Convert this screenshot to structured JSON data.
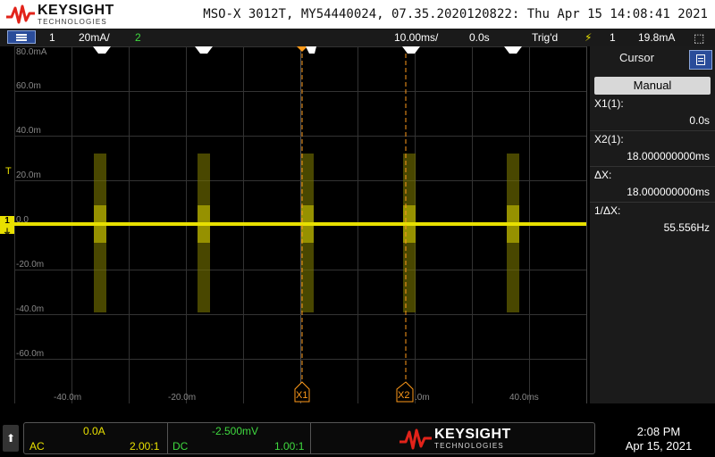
{
  "header": {
    "brand": "KEYSIGHT",
    "brand_sub": "TECHNOLOGIES",
    "info": "MSO-X 3012T, MY54440024, 07.35.2020120822: Thu Apr 15 14:08:41 2021"
  },
  "status": {
    "ch1_number": "1",
    "ch1_scale": "20mA/",
    "ch2_number": "2",
    "timebase": "10.00ms/",
    "delay": "0.0s",
    "trigger_state": "Trig'd",
    "trigger_channel": "1",
    "trigger_level": "19.8mA"
  },
  "graticule": {
    "y_labels": [
      "80.0mA",
      "60.0m",
      "40.0m",
      "20.0m",
      "0.0",
      "-20.0m",
      "-40.0m",
      "-60.0m"
    ],
    "x_labels": [
      "-40.0m",
      "-20.0m",
      "",
      "40.0ms"
    ],
    "cursor_x1_label": "X1",
    "cursor_x2_label": "X2",
    "cursor_x2_suffix": ".0m",
    "ch1_marker": "1",
    "trig_marker": "T"
  },
  "panel": {
    "title": "Cursor",
    "mode": "Manual",
    "x1_label": "X1(1):",
    "x1_value": "0.0s",
    "x2_label": "X2(1):",
    "x2_value": "18.000000000ms",
    "dx_label": "ΔX:",
    "dx_value": "18.000000000ms",
    "inv_dx_label": "1/ΔX:",
    "inv_dx_value": "55.556Hz"
  },
  "bottom": {
    "ch1_offset": "0.0A",
    "ch1_coupling": "AC",
    "ch1_probe": "2.00:1",
    "ch2_offset": "-2.500mV",
    "ch2_coupling": "DC",
    "ch2_probe": "1.00:1",
    "brand": "KEYSIGHT",
    "brand_sub": "TECHNOLOGIES",
    "time": "2:08 PM",
    "date": "Apr 15, 2021"
  },
  "colors": {
    "ch1": "#e8e000",
    "ch2": "#3fd93f",
    "cursor": "#ff9a1a",
    "accent_blue": "#2a4c9a"
  }
}
